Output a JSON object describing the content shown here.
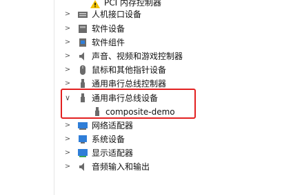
{
  "device_tree": {
    "cutoff_item": "PCI 内存控制器",
    "items": [
      {
        "label": "人机接口设备",
        "icon": "hid-icon",
        "expanded": false
      },
      {
        "label": "软件设备",
        "icon": "software-device-icon",
        "expanded": false
      },
      {
        "label": "软件组件",
        "icon": "software-component-icon",
        "expanded": false
      },
      {
        "label": "声音、视频和游戏控制器",
        "icon": "speaker-icon",
        "expanded": false
      },
      {
        "label": "鼠标和其他指针设备",
        "icon": "mouse-icon",
        "expanded": false
      },
      {
        "label": "通用串行总线控制器",
        "icon": "usb-icon",
        "expanded": false
      },
      {
        "label": "通用串行总线设备",
        "icon": "usb-icon",
        "expanded": true
      },
      {
        "label": "composite-demo",
        "icon": "usb-device-icon",
        "child": true
      },
      {
        "label": "网络适配器",
        "icon": "network-adapter-icon",
        "expanded": false
      },
      {
        "label": "系统设备",
        "icon": "system-device-icon",
        "expanded": false
      },
      {
        "label": "显示适配器",
        "icon": "display-adapter-icon",
        "expanded": false
      },
      {
        "label": "音频输入和输出",
        "icon": "audio-io-icon",
        "expanded": false
      }
    ]
  },
  "colors": {
    "highlight": "#e21f1f",
    "icon_blue": "#2f7ed8",
    "icon_gray": "#6b6b6b"
  }
}
